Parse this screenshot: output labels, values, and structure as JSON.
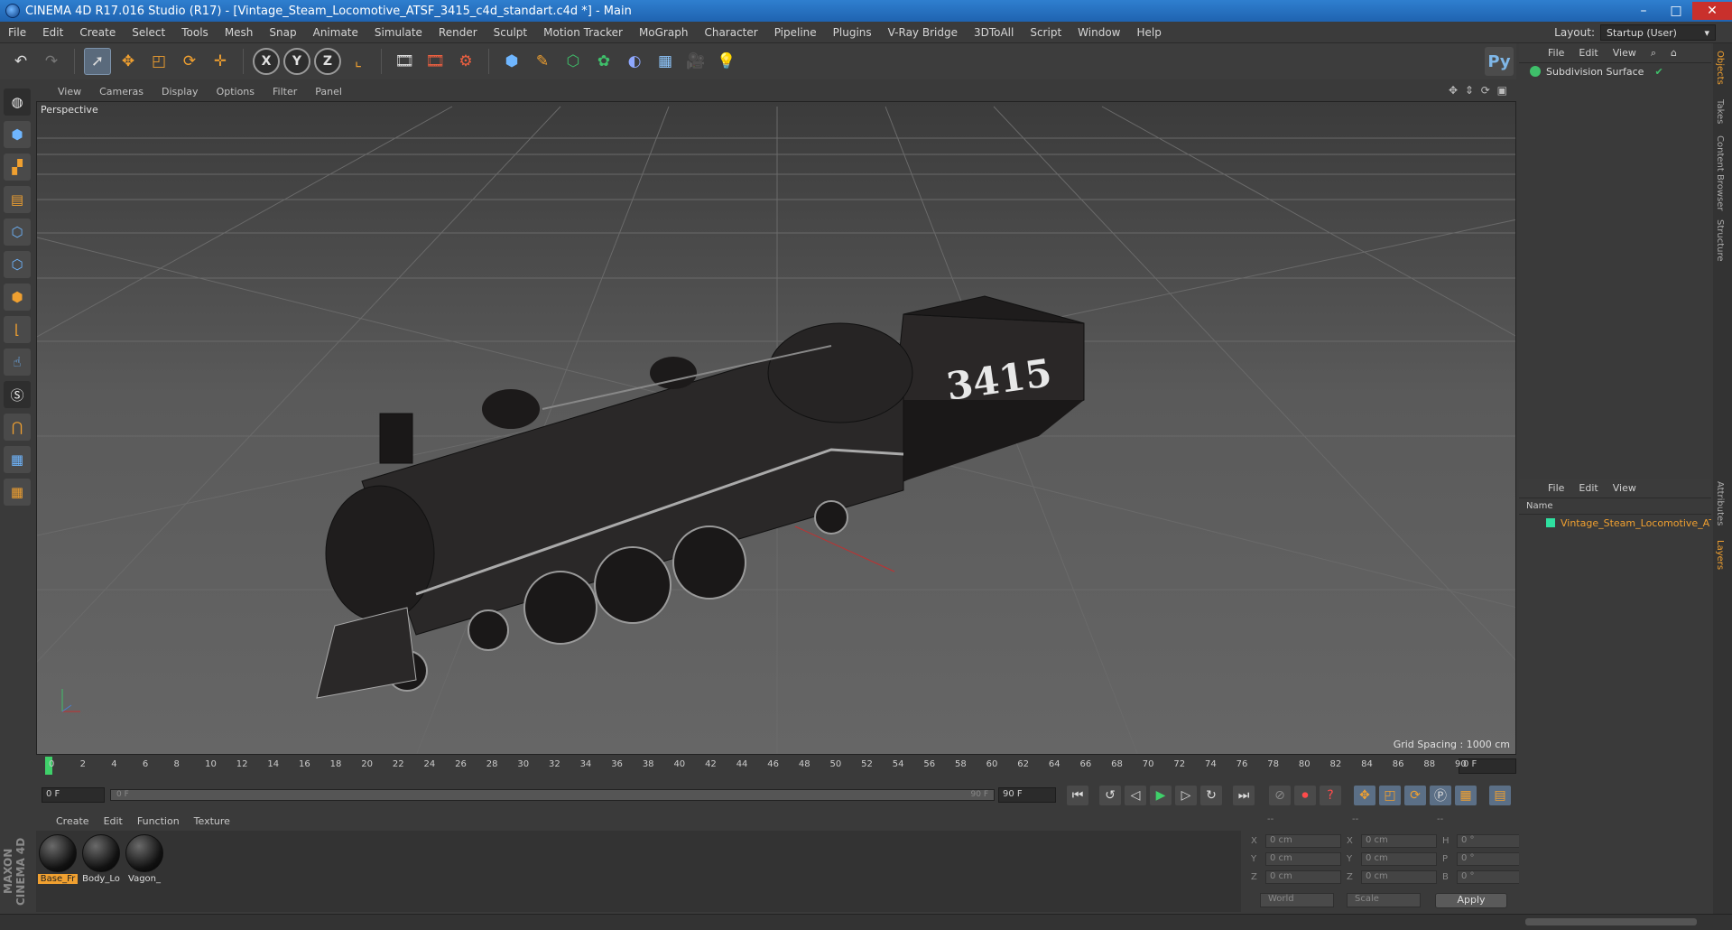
{
  "window": {
    "title": "CINEMA 4D R17.016 Studio (R17) - [Vintage_Steam_Locomotive_ATSF_3415_c4d_standart.c4d *] - Main",
    "minimize": "–",
    "maximize": "□",
    "close": "✕"
  },
  "menu": [
    "File",
    "Edit",
    "Create",
    "Select",
    "Tools",
    "Mesh",
    "Snap",
    "Animate",
    "Simulate",
    "Render",
    "Sculpt",
    "Motion Tracker",
    "MoGraph",
    "Character",
    "Pipeline",
    "Plugins",
    "V-Ray Bridge",
    "3DToAll",
    "Script",
    "Window",
    "Help"
  ],
  "layout": {
    "label": "Layout:",
    "value": "Startup (User)"
  },
  "toolbar": {
    "axis_x": "X",
    "axis_y": "Y",
    "axis_z": "Z"
  },
  "viewport": {
    "menus": [
      "View",
      "Cameras",
      "Display",
      "Options",
      "Filter",
      "Panel"
    ],
    "label": "Perspective",
    "grid_spacing": "Grid Spacing : 1000 cm",
    "tender_number": "3415"
  },
  "timeline": {
    "ticks": [
      "0",
      "2",
      "4",
      "6",
      "8",
      "10",
      "12",
      "14",
      "16",
      "18",
      "20",
      "22",
      "24",
      "26",
      "28",
      "30",
      "32",
      "34",
      "36",
      "38",
      "40",
      "42",
      "44",
      "46",
      "48",
      "50",
      "52",
      "54",
      "56",
      "58",
      "60",
      "62",
      "64",
      "66",
      "68",
      "70",
      "72",
      "74",
      "76",
      "78",
      "80",
      "82",
      "84",
      "86",
      "88",
      "90"
    ],
    "current_frame": "0 F",
    "start_frame": "0 F",
    "slider_start": "0 F",
    "slider_end": "90 F",
    "end_frame": "90 F"
  },
  "materials": {
    "menus": [
      "Create",
      "Edit",
      "Function",
      "Texture"
    ],
    "items": [
      {
        "name": "Base_Fr",
        "selected": true
      },
      {
        "name": "Body_Lo",
        "selected": false
      },
      {
        "name": "Vagon_",
        "selected": false
      }
    ]
  },
  "coordinates": {
    "headers": [
      "--",
      "--",
      "--"
    ],
    "rows": [
      {
        "a": "X",
        "v1": "0 cm",
        "b": "X",
        "v2": "0 cm",
        "c": "H",
        "v3": "0 °"
      },
      {
        "a": "Y",
        "v1": "0 cm",
        "b": "Y",
        "v2": "0 cm",
        "c": "P",
        "v3": "0 °"
      },
      {
        "a": "Z",
        "v1": "0 cm",
        "b": "Z",
        "v2": "0 cm",
        "c": "B",
        "v3": "0 °"
      }
    ],
    "world": "World",
    "scale": "Scale",
    "apply": "Apply"
  },
  "objects": {
    "menus": [
      "File",
      "Edit",
      "View"
    ],
    "items": [
      "Subdivision Surface"
    ]
  },
  "layers": {
    "menus": [
      "File",
      "Edit",
      "View"
    ],
    "column": "Name",
    "items": [
      "Vintage_Steam_Locomotive_ATSF_"
    ]
  },
  "side_tabs": [
    "Objects",
    "Takes",
    "Content Browser",
    "Structure",
    "Attributes",
    "Layers"
  ],
  "brand": "MAXON CINEMA 4D"
}
